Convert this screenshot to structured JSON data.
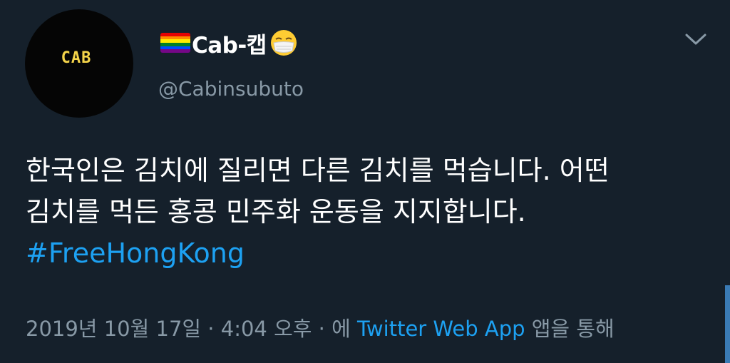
{
  "user": {
    "avatar_text": "CAB",
    "display_name": "Cab-캡",
    "handle": "@Cabinsubuto",
    "flag_colors": [
      "#e40303",
      "#ff8c00",
      "#ffed00",
      "#008026",
      "#004dff",
      "#750787"
    ]
  },
  "tweet": {
    "line1": "한국인은 김치에 질리면 다른 김치를 먹습니다. 어떤",
    "line2": "김치를 먹든 홍콩 민주화 운동을 지지합니다.",
    "hashtag": "#FreeHongKong"
  },
  "meta": {
    "date": "2019년 10월 17일",
    "sep1": " · ",
    "time": "4:04 오후",
    "sep2": " · 에 ",
    "source": "Twitter Web App",
    "suffix": " 앱을 통해"
  },
  "icons": {
    "caret": "chevron-down-icon",
    "emoji": "face-with-medical-mask-icon",
    "flag": "rainbow-flag-icon"
  },
  "colors": {
    "background": "#15202b",
    "text": "#ffffff",
    "secondary": "#8899a6",
    "link": "#1da1f2"
  }
}
